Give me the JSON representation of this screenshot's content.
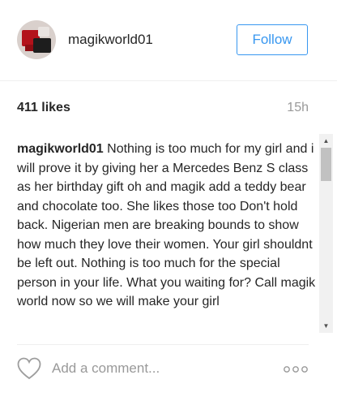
{
  "header": {
    "username": "magikworld01",
    "follow_label": "Follow"
  },
  "stats": {
    "likes": "411 likes",
    "time": "15h"
  },
  "caption": {
    "username": "magikworld01",
    "text": "Nothing is too much for my girl and i will prove it by giving her a Mercedes Benz S class as her birthday gift oh and magik add a teddy bear and chocolate too. She likes those too Don't hold back. Nigerian men are breaking bounds to show how much they love their women. Your girl shouldnt be left out. Nothing is too much for the special person in your life. What you waiting for? Call magik world now so we will make your girl"
  },
  "footer": {
    "comment_placeholder": "Add a comment..."
  },
  "icons": {
    "heart": "heart-icon",
    "more": "more-options-icon"
  },
  "colors": {
    "accent": "#3897f0",
    "text": "#262626",
    "muted": "#999999"
  }
}
